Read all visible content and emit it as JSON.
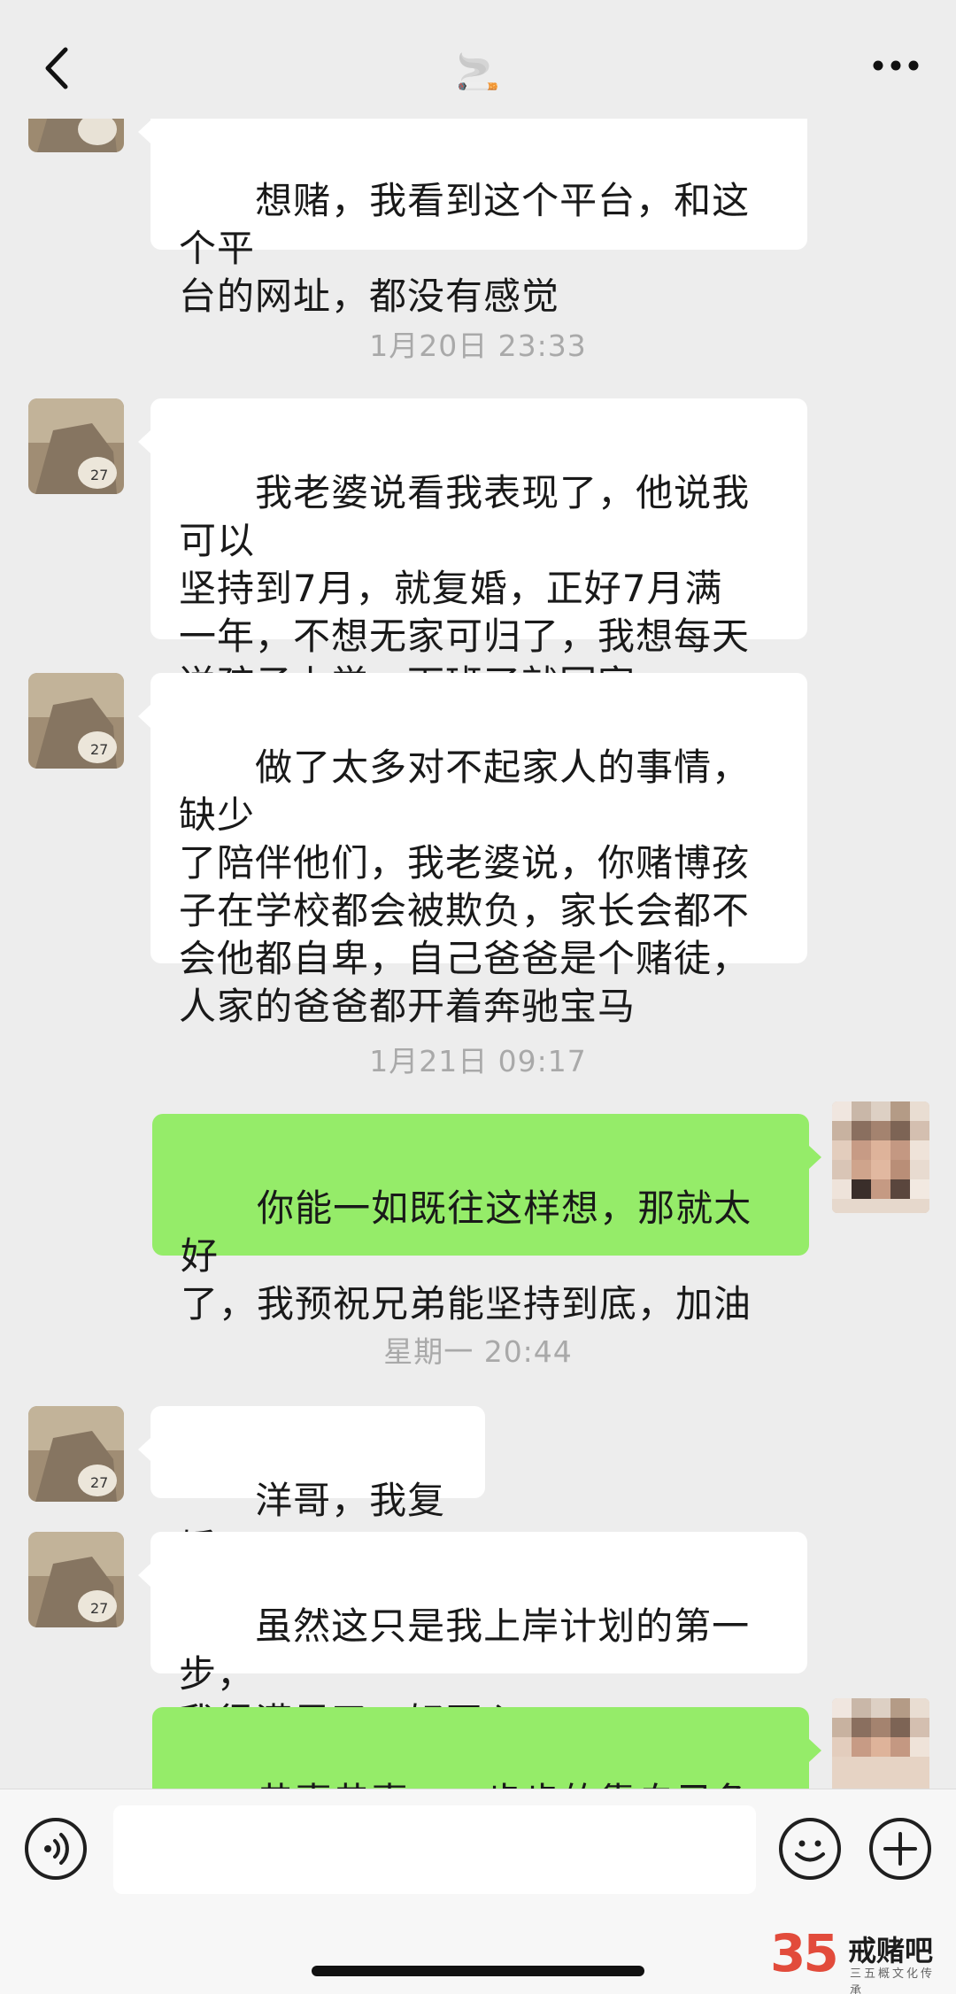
{
  "header": {
    "title_emoji": "🚬"
  },
  "messages": [
    {
      "id": "m0",
      "text": "想赌，我看到这个平台，和这个平\n台的网址，都没有感觉"
    },
    {
      "id": "t1",
      "time": "1月20日 23:33"
    },
    {
      "id": "m1",
      "text": "我老婆说看我表现了，他说我可以\n坚持到7月，就复婚，正好7月满\n一年，不想无家可归了，我想每天\n送孩子上学，下班了就回家"
    },
    {
      "id": "m2",
      "text": "做了太多对不起家人的事情，缺少\n了陪伴他们，我老婆说，你赌博孩\n子在学校都会被欺负，家长会都不\n会他都自卑，自己爸爸是个赌徒，\n人家的爸爸都开着奔驰宝马"
    },
    {
      "id": "t2",
      "time": "1月21日 09:17"
    },
    {
      "id": "m3",
      "text": "你能一如既往这样想，那就太好\n了，我预祝兄弟能坚持到底，加油"
    },
    {
      "id": "t3",
      "time": "星期一 20:44"
    },
    {
      "id": "m4",
      "text": "洋哥，我复婚了"
    },
    {
      "id": "m5",
      "text": "虽然这只是我上岸计划的第一步，\n我很满足了，好开心"
    },
    {
      "id": "m6",
      "text": "恭喜恭喜，一步步的靠自己争取，"
    }
  ],
  "watermark": {
    "number": "35",
    "name": "戒赌吧",
    "tagline": "三五概文化传承"
  },
  "colors": {
    "background": "#ededed",
    "bubble_left": "#ffffff",
    "bubble_right": "#95ec69",
    "timestamp": "#a9a9a9"
  },
  "icons": [
    "back-icon",
    "more-icon",
    "voice-icon",
    "emoji-icon",
    "plus-icon"
  ]
}
